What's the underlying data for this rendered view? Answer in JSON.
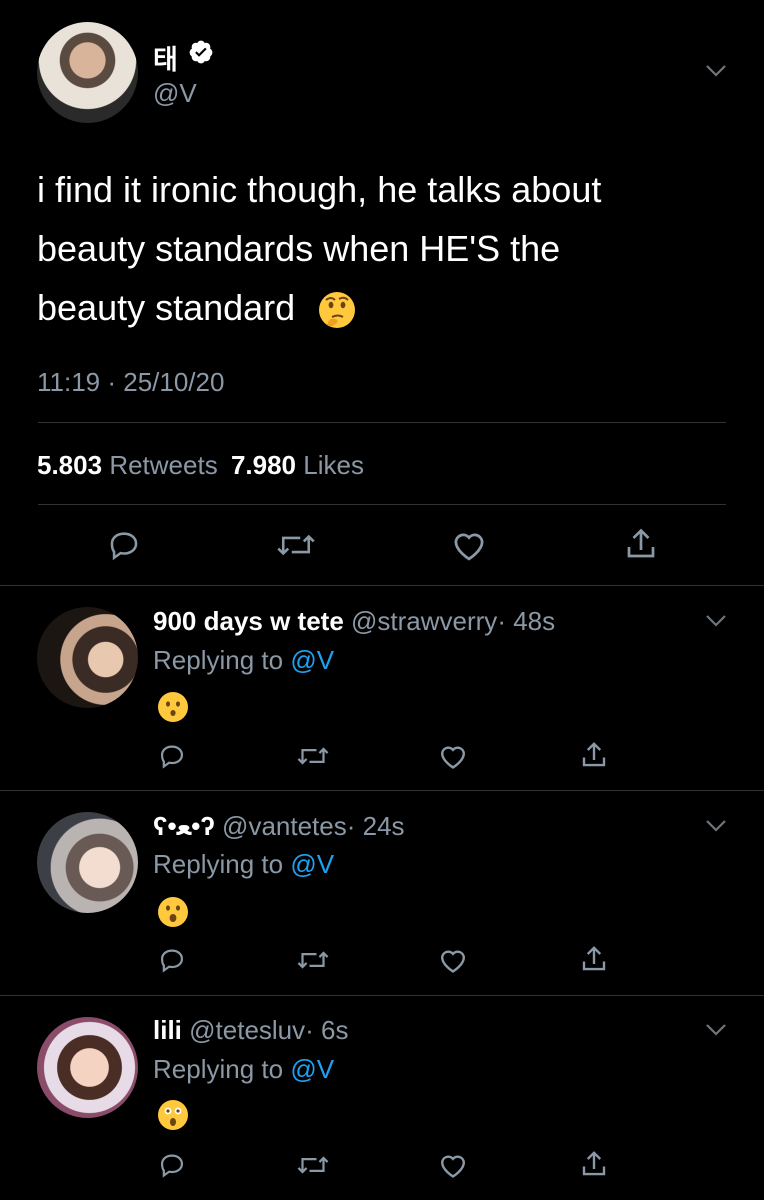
{
  "colors": {
    "background": "#000000",
    "text": "#ffffff",
    "secondary": "#8b98a5",
    "link": "#1da1f2",
    "verified": "#ffffff"
  },
  "main_tweet": {
    "display_name": "태",
    "handle": "@V",
    "text_line1": "i find it ironic though, he talks about",
    "text_line2": "beauty standards when HE'S the",
    "text_line3": "beauty standard",
    "emoji": "thinking-face",
    "timestamp": "11:19 · 25/10/20",
    "retweets_count": "5.803",
    "retweets_label": "Retweets",
    "likes_count": "7.980",
    "likes_label": "Likes"
  },
  "replies": [
    {
      "display_name": "900 days w tete",
      "handle": "@strawverry",
      "time": "· 48s",
      "replying_to": "Replying to",
      "mention": "@V",
      "emoji": "hushed-face"
    },
    {
      "display_name": "ʕ•ﻌ•ʔ",
      "handle": "@vantetes",
      "time": "· 24s",
      "replying_to": "Replying to",
      "mention": "@V",
      "emoji": "open-mouth-face"
    },
    {
      "display_name": "lili",
      "handle": "@tetesluv",
      "time": "· 6s",
      "replying_to": "Replying to",
      "mention": "@V",
      "emoji": "astonished-face"
    }
  ]
}
